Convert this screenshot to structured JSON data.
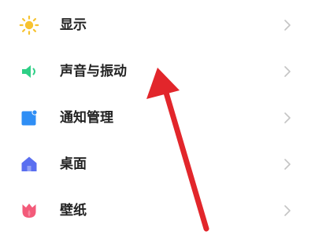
{
  "settings": {
    "items": [
      {
        "label": "显示",
        "icon": "sun-icon"
      },
      {
        "label": "声音与振动",
        "icon": "speaker-icon"
      },
      {
        "label": "通知管理",
        "icon": "notification-icon"
      },
      {
        "label": "桌面",
        "icon": "home-icon"
      },
      {
        "label": "壁纸",
        "icon": "tulip-icon"
      }
    ]
  },
  "colors": {
    "display_icon": "#f7c331",
    "sound_icon": "#2ecf86",
    "notification_icon": "#2f8ef5",
    "desktop_icon": "#5a6ff0",
    "wallpaper_icon": "#f35b7a",
    "chevron": "#c4c4c4",
    "annotation_arrow": "#e2262b"
  }
}
